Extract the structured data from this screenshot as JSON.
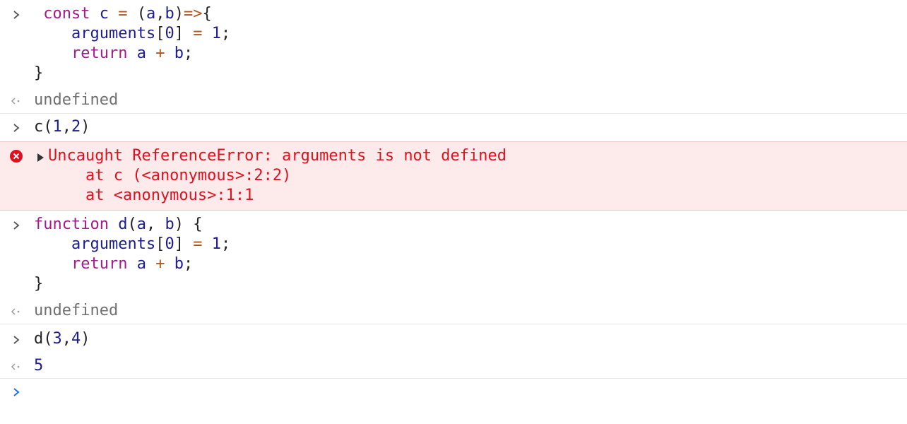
{
  "console": {
    "entries": [
      {
        "kind": "input",
        "lines": [
          [
            [
              "kw",
              " const"
            ],
            [
              "punct",
              " "
            ],
            [
              "ident",
              "c"
            ],
            [
              "punct",
              " "
            ],
            [
              "op",
              "="
            ],
            [
              "punct",
              " ("
            ],
            [
              "ident",
              "a"
            ],
            [
              "punct",
              ","
            ],
            [
              "ident",
              "b"
            ],
            [
              "punct",
              ")"
            ],
            [
              "op",
              "=>"
            ],
            [
              "punct",
              "{"
            ]
          ],
          [
            [
              "punct",
              "    "
            ],
            [
              "ident",
              "arguments"
            ],
            [
              "punct",
              "["
            ],
            [
              "num",
              "0"
            ],
            [
              "punct",
              "] "
            ],
            [
              "op",
              "="
            ],
            [
              "punct",
              " "
            ],
            [
              "num",
              "1"
            ],
            [
              "punct",
              ";"
            ]
          ],
          [
            [
              "punct",
              "    "
            ],
            [
              "kw",
              "return"
            ],
            [
              "punct",
              " "
            ],
            [
              "ident",
              "a"
            ],
            [
              "punct",
              " "
            ],
            [
              "op",
              "+"
            ],
            [
              "punct",
              " "
            ],
            [
              "ident",
              "b"
            ],
            [
              "punct",
              ";"
            ]
          ],
          [
            [
              "punct",
              "}"
            ]
          ]
        ]
      },
      {
        "kind": "result",
        "text": "undefined",
        "style": "undef"
      },
      {
        "kind": "input",
        "lines": [
          [
            [
              "punct",
              "c("
            ],
            [
              "num",
              "1"
            ],
            [
              "punct",
              ","
            ],
            [
              "num",
              "2"
            ],
            [
              "punct",
              ")"
            ]
          ]
        ]
      },
      {
        "kind": "error",
        "lines": [
          "Uncaught ReferenceError: arguments is not defined",
          "    at c (<anonymous>:2:2)",
          "    at <anonymous>:1:1"
        ]
      },
      {
        "kind": "input",
        "lines": [
          [
            [
              "kw",
              "function"
            ],
            [
              "punct",
              " "
            ],
            [
              "ident",
              "d"
            ],
            [
              "punct",
              "("
            ],
            [
              "ident",
              "a"
            ],
            [
              "punct",
              ", "
            ],
            [
              "ident",
              "b"
            ],
            [
              "punct",
              ") {"
            ]
          ],
          [
            [
              "punct",
              "    "
            ],
            [
              "ident",
              "arguments"
            ],
            [
              "punct",
              "["
            ],
            [
              "num",
              "0"
            ],
            [
              "punct",
              "] "
            ],
            [
              "op",
              "="
            ],
            [
              "punct",
              " "
            ],
            [
              "num",
              "1"
            ],
            [
              "punct",
              ";"
            ]
          ],
          [
            [
              "punct",
              "    "
            ],
            [
              "kw",
              "return"
            ],
            [
              "punct",
              " "
            ],
            [
              "ident",
              "a"
            ],
            [
              "punct",
              " "
            ],
            [
              "op",
              "+"
            ],
            [
              "punct",
              " "
            ],
            [
              "ident",
              "b"
            ],
            [
              "punct",
              ";"
            ]
          ],
          [
            [
              "punct",
              "}"
            ]
          ]
        ]
      },
      {
        "kind": "result",
        "text": "undefined",
        "style": "undef"
      },
      {
        "kind": "input",
        "lines": [
          [
            [
              "punct",
              "d("
            ],
            [
              "num",
              "3"
            ],
            [
              "punct",
              ","
            ],
            [
              "num",
              "4"
            ],
            [
              "punct",
              ")"
            ]
          ]
        ]
      },
      {
        "kind": "result",
        "text": "5",
        "style": "num"
      }
    ],
    "prompt": {
      "value": ""
    }
  },
  "colors": {
    "keyword": "#a31a8c",
    "identifier": "#1d1d8f",
    "operator": "#b0561a",
    "error": "#e0101e",
    "error_bg": "#fdebec",
    "prompt_active": "#1a73e8",
    "muted": "#707070"
  },
  "icons": {
    "input_prompt": "chevron-right-icon",
    "result_marker": "return-arrow-icon",
    "error_marker": "error-circle-icon",
    "expand": "triangle-right-icon"
  }
}
